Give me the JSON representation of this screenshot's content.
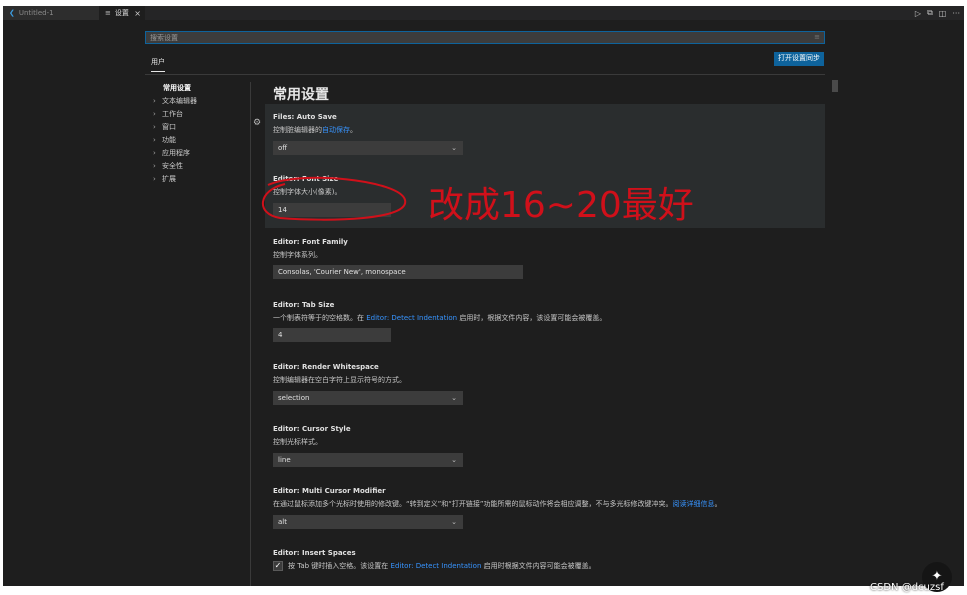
{
  "tabs": [
    {
      "label": "Untitled-1",
      "icon": "file-icon",
      "active": false
    },
    {
      "label": "设置",
      "icon": "settings-icon",
      "active": true,
      "close": "×"
    }
  ],
  "toolbar": {
    "icons": [
      "run-icon",
      "copy-icon",
      "split-icon",
      "more-icon"
    ],
    "more": "···",
    "split": "◫",
    "run": "▷",
    "copy": "⧉"
  },
  "search": {
    "placeholder": "搜索设置",
    "clear": "≡"
  },
  "scope": {
    "user": "用户",
    "sync_button": "打开设置同步"
  },
  "toc": {
    "active": "常用设置",
    "items": [
      "文本编辑器",
      "工作台",
      "窗口",
      "功能",
      "应用程序",
      "安全性",
      "扩展"
    ],
    "chevron": "›"
  },
  "page_title": "常用设置",
  "settings": {
    "auto_save": {
      "title": "Files: Auto Save",
      "desc_pre": "控制脏编辑器的",
      "desc_link": "自动保存",
      "desc_post": "。",
      "value": "off"
    },
    "font_size": {
      "title": "Editor: Font Size",
      "desc": "控制字体大小(像素)。",
      "value": "14"
    },
    "font_family": {
      "title": "Editor: Font Family",
      "desc": "控制字体系列。",
      "value": "Consolas, 'Courier New', monospace"
    },
    "tab_size": {
      "title": "Editor: Tab Size",
      "desc_pre": "一个制表符等于的空格数。在 ",
      "desc_link": "Editor: Detect Indentation",
      "desc_post": " 启用时，根据文件内容，该设置可能会被覆盖。",
      "value": "4"
    },
    "render_whitespace": {
      "title": "Editor: Render Whitespace",
      "desc": "控制编辑器在空白字符上显示符号的方式。",
      "value": "selection"
    },
    "cursor_style": {
      "title": "Editor: Cursor Style",
      "desc": "控制光标样式。",
      "value": "line"
    },
    "multi_cursor": {
      "title": "Editor: Multi Cursor Modifier",
      "desc_pre": "在通过鼠标添加多个光标时使用的修改键。“转到定义”和“打开链接”功能所需的鼠标动作将会相应调整，不与多光标修改键冲突。",
      "desc_link": "阅读详细信息",
      "desc_post": "。",
      "value": "alt"
    },
    "insert_spaces": {
      "title": "Editor: Insert Spaces",
      "desc_pre": "按 Tab 键时插入空格。该设置在 ",
      "desc_link": "Editor: Detect Indentation",
      "desc_post": " 启用时根据文件内容可能会被覆盖。",
      "checked": true,
      "check": "✓"
    }
  },
  "annotation": {
    "text": "改成16~20最好",
    "color": "#d0101a"
  },
  "watermark": "CSDN @dcuzsf",
  "status_color": "#68217a",
  "caret": "⌄",
  "gear": "⚙",
  "magic": "✦"
}
